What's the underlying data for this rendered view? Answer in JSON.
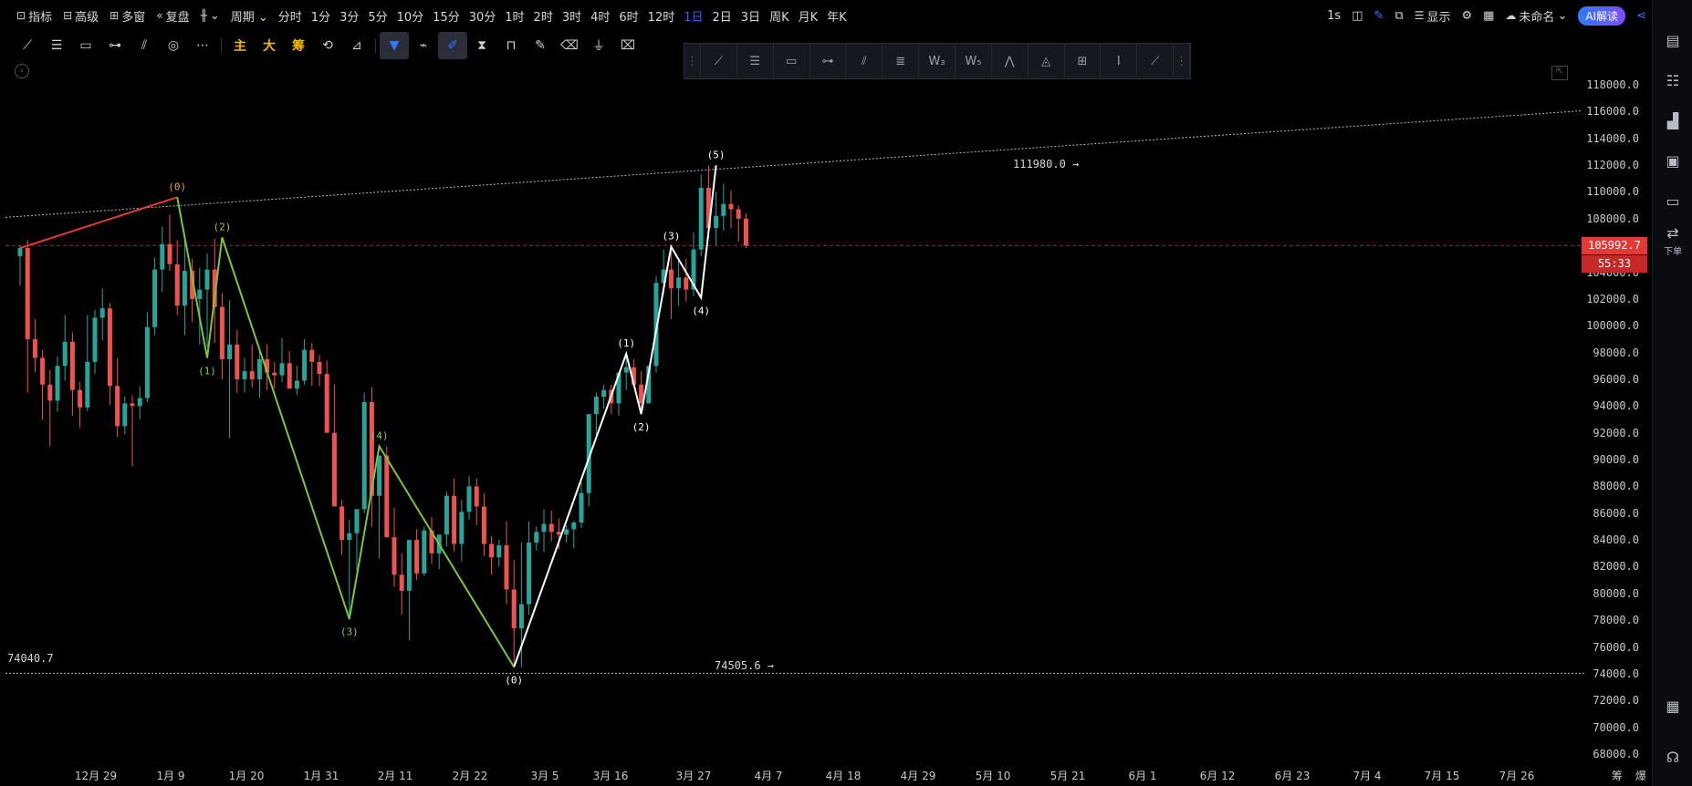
{
  "topbar": {
    "items": [
      {
        "icon": "indicator-icon",
        "glyph": "⊡",
        "label": "指标"
      },
      {
        "icon": "advanced-icon",
        "glyph": "⊟",
        "label": "高级"
      },
      {
        "icon": "multi-window-icon",
        "glyph": "⊞",
        "label": "多窗"
      },
      {
        "icon": "replay-icon",
        "glyph": "«",
        "label": "复盘"
      },
      {
        "icon": "chart-type-icon",
        "glyph": "╫",
        "label": "⌄"
      },
      {
        "icon": "",
        "glyph": "",
        "label": "周期 ⌄"
      }
    ],
    "periods": [
      "分时",
      "1分",
      "3分",
      "5分",
      "10分",
      "15分",
      "30分",
      "1时",
      "2时",
      "3时",
      "4时",
      "6时",
      "12时",
      "1日",
      "2日",
      "3日",
      "周K",
      "月K",
      "年K"
    ],
    "active_period": "1日",
    "right": {
      "interval": "1s",
      "display_label": "显示",
      "unnamed_label": "未命名",
      "ai_label": "AI解读"
    }
  },
  "toolbar2": {
    "text_tools": [
      "主",
      "大",
      "筹"
    ]
  },
  "rightbar": {
    "order_label": "下单"
  },
  "colors": {
    "up": "#26a69a",
    "down": "#ef5350",
    "wave_red": "#e53935",
    "wave_green": "#7cc63a",
    "wave_white": "#ffffff",
    "label_orange": "#f0a030",
    "label_green": "#8bd04a",
    "accent_blue": "#2f7bff"
  },
  "price_axis": {
    "ticks": [
      "118000.0",
      "116000.0",
      "114000.0",
      "112000.0",
      "110000.0",
      "108000.0",
      "106000.0",
      "104000.0",
      "102000.0",
      "100000.0",
      "98000.0",
      "96000.0",
      "94000.0",
      "92000.0",
      "90000.0",
      "88000.0",
      "86000.0",
      "84000.0",
      "82000.0",
      "80000.0",
      "78000.0",
      "76000.0",
      "74000.0",
      "72000.0",
      "70000.0",
      "68000.0"
    ],
    "current_price": "105992.7",
    "countdown": "55:33"
  },
  "time_axis": {
    "labels": [
      "12月 29",
      "1月 9",
      "1月 20",
      "1月 31",
      "2月 11",
      "2月 22",
      "3月 5",
      "3月 16",
      "3月 27",
      "4月 7",
      "4月 18",
      "4月 29",
      "5月 10",
      "5月 21",
      "6月 1",
      "6月 12",
      "6月 23",
      "7月 4",
      "7月 15",
      "7月 26"
    ],
    "corner_labels": [
      "筹",
      "爆"
    ]
  },
  "chart_data": {
    "type": "candlestick",
    "title": "",
    "y_range": [
      67000,
      119000
    ],
    "horizontal_level": {
      "value": 74040.7,
      "label": "74040.7"
    },
    "current_price_line": 105992.7,
    "annotations": {
      "low_label": "74505.6 →",
      "high_label": "111980.0 →"
    },
    "waves": [
      {
        "name": "red",
        "color_key": "wave_red",
        "points": [
          {
            "x": 0,
            "y": 105800
          },
          {
            "x": 21,
            "y": 109600
          }
        ],
        "labels": [
          {
            "text": "(0)",
            "at": 1
          }
        ]
      },
      {
        "name": "green",
        "color_key": "wave_green",
        "points": [
          {
            "x": 21,
            "y": 109600
          },
          {
            "x": 25,
            "y": 97600
          },
          {
            "x": 27,
            "y": 106600
          },
          {
            "x": 44,
            "y": 78100
          },
          {
            "x": 48,
            "y": 91000
          },
          {
            "x": 66,
            "y": 74505.6
          }
        ],
        "labels": [
          {
            "text": "(1)",
            "at": 1
          },
          {
            "text": "(2)",
            "at": 2
          },
          {
            "text": "(3)",
            "at": 3
          },
          {
            "text": "(4)",
            "at": 4
          }
        ]
      },
      {
        "name": "white",
        "color_key": "wave_white",
        "points": [
          {
            "x": 66,
            "y": 74505.6
          },
          {
            "x": 81,
            "y": 97900
          },
          {
            "x": 83,
            "y": 93400
          },
          {
            "x": 87,
            "y": 105900
          },
          {
            "x": 91,
            "y": 102100
          },
          {
            "x": 93,
            "y": 111980
          }
        ],
        "labels": [
          {
            "text": "(0)",
            "at": 0
          },
          {
            "text": "(1)",
            "at": 1
          },
          {
            "text": "(2)",
            "at": 2
          },
          {
            "text": "(3)",
            "at": 3
          },
          {
            "text": "(4)",
            "at": 4
          },
          {
            "text": "(5)",
            "at": 5
          }
        ]
      }
    ],
    "candles": [
      [
        105200,
        106000,
        103000,
        105800
      ],
      [
        105800,
        106400,
        95000,
        99000
      ],
      [
        99000,
        100500,
        96500,
        97600
      ],
      [
        97600,
        98200,
        93000,
        95600
      ],
      [
        95600,
        96700,
        91000,
        94400
      ],
      [
        94400,
        97700,
        93600,
        97000
      ],
      [
        97000,
        100800,
        95900,
        98800
      ],
      [
        98800,
        99500,
        93300,
        95200
      ],
      [
        95200,
        95800,
        92400,
        93900
      ],
      [
        93900,
        100800,
        93600,
        97300
      ],
      [
        97300,
        101200,
        96400,
        100600
      ],
      [
        100600,
        102800,
        98900,
        101300
      ],
      [
        101300,
        101700,
        94100,
        95500
      ],
      [
        95500,
        97600,
        91700,
        92500
      ],
      [
        92500,
        94700,
        91900,
        94200
      ],
      [
        94200,
        94800,
        89500,
        94000
      ],
      [
        94000,
        95500,
        93000,
        94600
      ],
      [
        94600,
        101000,
        94300,
        99900
      ],
      [
        99900,
        105100,
        99300,
        104200
      ],
      [
        104200,
        107400,
        102500,
        106100
      ],
      [
        106100,
        108300,
        104100,
        104600
      ],
      [
        104600,
        106400,
        100800,
        101500
      ],
      [
        101500,
        106400,
        99300,
        104100
      ],
      [
        104100,
        105000,
        100300,
        102000
      ],
      [
        102000,
        104300,
        98600,
        102700
      ],
      [
        102700,
        105400,
        98400,
        104200
      ],
      [
        104200,
        106500,
        98700,
        101400
      ],
      [
        101400,
        102400,
        96000,
        97500
      ],
      [
        97500,
        101900,
        91600,
        98600
      ],
      [
        98600,
        99700,
        95000,
        96000
      ],
      [
        96000,
        97600,
        95000,
        96600
      ],
      [
        96600,
        98600,
        95400,
        96000
      ],
      [
        96000,
        98200,
        94600,
        97500
      ],
      [
        97500,
        98600,
        95200,
        96500
      ],
      [
        96500,
        97300,
        95300,
        96300
      ],
      [
        96300,
        99100,
        95800,
        97200
      ],
      [
        97200,
        98100,
        95800,
        95300
      ],
      [
        95300,
        97000,
        94800,
        95900
      ],
      [
        95900,
        99000,
        95600,
        98200
      ],
      [
        98200,
        98700,
        95500,
        97300
      ],
      [
        97300,
        97800,
        95500,
        96400
      ],
      [
        96400,
        97400,
        92600,
        92000
      ],
      [
        92000,
        95600,
        91400,
        86500
      ],
      [
        86500,
        87000,
        82900,
        84000
      ],
      [
        84000,
        85500,
        78000,
        84500
      ],
      [
        84500,
        86200,
        81700,
        86300
      ],
      [
        86300,
        95000,
        86000,
        94300
      ],
      [
        94300,
        95400,
        85000,
        87300
      ],
      [
        87300,
        90300,
        82600,
        90300
      ],
      [
        90300,
        91000,
        85000,
        84200
      ],
      [
        84200,
        86400,
        80500,
        81400
      ],
      [
        81400,
        83000,
        78400,
        80200
      ],
      [
        80200,
        84000,
        76500,
        84000
      ],
      [
        84000,
        84800,
        81000,
        81500
      ],
      [
        81500,
        85000,
        81300,
        84700
      ],
      [
        84700,
        85700,
        82200,
        83000
      ],
      [
        83000,
        84300,
        81800,
        84400
      ],
      [
        84400,
        87600,
        83500,
        87300
      ],
      [
        87300,
        88600,
        83100,
        83700
      ],
      [
        83700,
        87000,
        82400,
        86100
      ],
      [
        86100,
        88800,
        85500,
        88000
      ],
      [
        88000,
        88600,
        85100,
        86500
      ],
      [
        86500,
        87500,
        82800,
        83700
      ],
      [
        83700,
        84300,
        81400,
        82700
      ],
      [
        82700,
        84000,
        82000,
        83600
      ],
      [
        83600,
        85400,
        79200,
        80300
      ],
      [
        80300,
        82500,
        74500,
        77400
      ],
      [
        77400,
        83800,
        74500,
        79200
      ],
      [
        79200,
        85400,
        78400,
        83800
      ],
      [
        83800,
        85000,
        83200,
        84600
      ],
      [
        84600,
        86300,
        83100,
        85200
      ],
      [
        85200,
        86200,
        83900,
        84600
      ],
      [
        84600,
        85600,
        83300,
        84400
      ],
      [
        84400,
        85100,
        83800,
        84800
      ],
      [
        84800,
        85400,
        83400,
        85300
      ],
      [
        85300,
        88300,
        84900,
        87500
      ],
      [
        87500,
        92800,
        86500,
        93400
      ],
      [
        93400,
        95000,
        91500,
        94700
      ],
      [
        94700,
        95600,
        93800,
        95200
      ],
      [
        95200,
        95600,
        93400,
        94200
      ],
      [
        94200,
        96100,
        93300,
        96500
      ],
      [
        96500,
        97900,
        95200,
        96900
      ],
      [
        96900,
        97500,
        95800,
        95600
      ],
      [
        95600,
        96600,
        93600,
        94200
      ],
      [
        94200,
        96900,
        94500,
        97000
      ],
      [
        97000,
        103700,
        96500,
        103200
      ],
      [
        103200,
        105700,
        102300,
        104200
      ],
      [
        104200,
        105900,
        100500,
        102800
      ],
      [
        102800,
        104900,
        101500,
        103600
      ],
      [
        103600,
        105000,
        101800,
        102700
      ],
      [
        102700,
        107000,
        102200,
        105700
      ],
      [
        105700,
        111300,
        105200,
        110300
      ],
      [
        110300,
        111980,
        106500,
        107300
      ],
      [
        107300,
        110000,
        106000,
        108200
      ],
      [
        108200,
        110600,
        107100,
        109100
      ],
      [
        109100,
        110100,
        107300,
        108700
      ],
      [
        108700,
        109000,
        106300,
        108000
      ],
      [
        108000,
        108400,
        105800,
        105992.7
      ]
    ]
  }
}
